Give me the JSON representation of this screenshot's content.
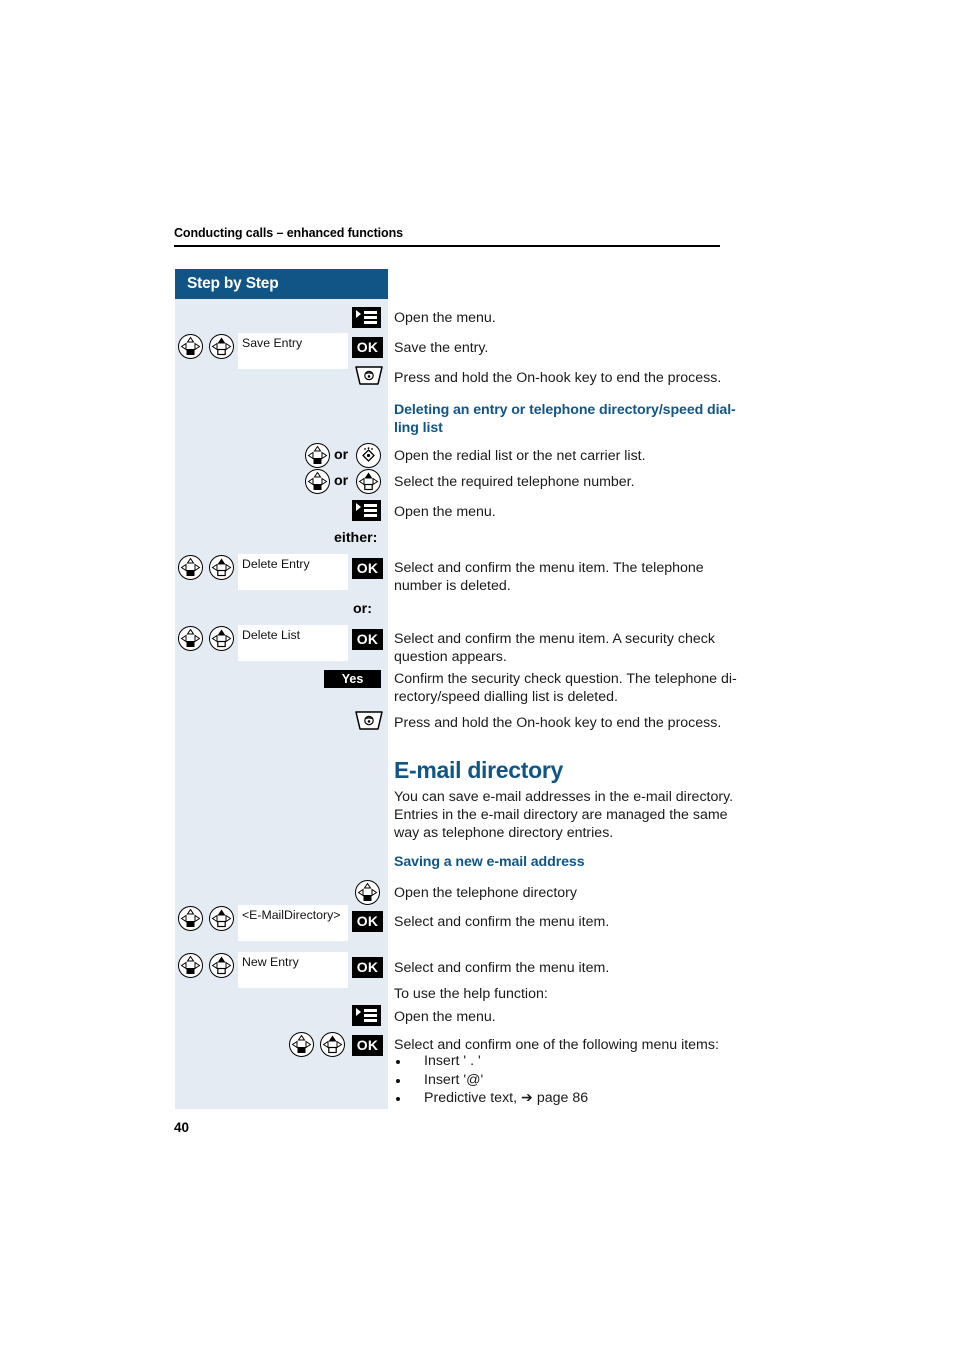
{
  "document": {
    "running_header": "Conducting calls – enhanced functions",
    "page_number": "40",
    "accent_color": "#115586",
    "sidebar_bg": "#e4ebf3"
  },
  "sidebar": {
    "title": "Step by Step",
    "either_label": "either:",
    "or_label": "or:",
    "or_word": "or",
    "keys": {
      "ok": "OK",
      "yes": "Yes"
    },
    "displays": {
      "save_entry": "Save Entry",
      "delete_entry": "Delete Entry",
      "delete_list": "Delete List",
      "email_directory": "<E-MailDirectory>",
      "new_entry": "New Entry"
    },
    "icons": {
      "menu": "menu-key-icon",
      "on_hook": "on-hook-key-icon",
      "navigator_down": "navigator-key-down-icon",
      "navigator_up": "navigator-key-up-icon",
      "redial": "redial-key-icon"
    }
  },
  "main": {
    "steps": [
      {
        "id": "open-menu-1",
        "text": "Open the menu."
      },
      {
        "id": "save-entry",
        "text": "Save the entry."
      },
      {
        "id": "end-process-1",
        "text": "Press and hold the On-hook key to end the process."
      }
    ],
    "heading_delete": "Deleting an entry or telephone directory/speed dial-\nling list",
    "heading_delete_line1": "Deleting an entry or telephone directory/speed dial-",
    "heading_delete_line2": "ling list",
    "steps_delete": [
      {
        "id": "open-redial-list",
        "text": "Open the redial list or the net carrier list."
      },
      {
        "id": "select-number",
        "text": "Select the required telephone number."
      },
      {
        "id": "open-menu-2",
        "text": "Open the menu."
      }
    ],
    "delete_entry_text_l1": "Select and confirm the menu item. The telephone",
    "delete_entry_text_l2": "number is deleted.",
    "delete_list_text_l1": "Select and confirm the menu item. A security check",
    "delete_list_text_l2": "question appears.",
    "yes_text_l1": "Confirm the security check question. The telephone di-",
    "yes_text_l2": "rectory/speed dialling list is deleted.",
    "end_process_2": "Press and hold the On-hook key to end the process.",
    "email_title": "E-mail directory",
    "email_body_l1": "You can save e-mail addresses in the e-mail directory.",
    "email_body_l2": "Entries in the e-mail directory are managed the same",
    "email_body_l3": "way as telephone directory entries.",
    "saving_heading": "Saving a new e-mail address",
    "open_directory": "Open the telephone directory",
    "select_confirm_1": "Select and confirm the menu item.",
    "select_confirm_2": "Select and confirm the menu item.",
    "help_function": "To use the help function:",
    "open_menu_3": "Open the menu.",
    "select_confirm_list": "Select and confirm one of the following menu items:",
    "bullets": [
      "Insert ' . '",
      "Insert '@'",
      "Predictive text, ➔ page 86"
    ]
  }
}
